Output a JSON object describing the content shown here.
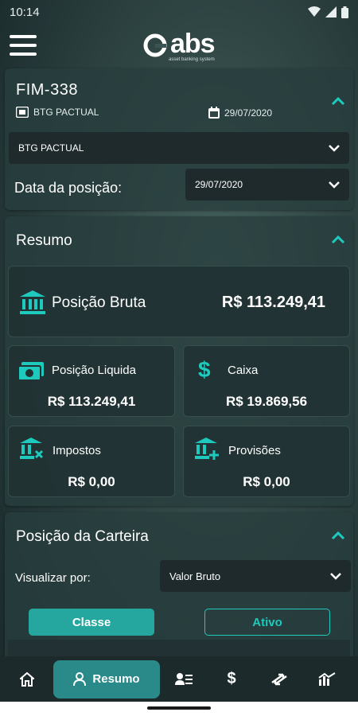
{
  "status_bar": {
    "time": "10:14"
  },
  "brand": {
    "name": "abs",
    "tagline": "asset banking system"
  },
  "colors": {
    "accent": "#1ec9bd",
    "button_fill": "#25a79f",
    "active_nav": "#2a8a8a",
    "card": "#283e3e",
    "select_bg": "#1f2a2c"
  },
  "header_card": {
    "fund_code": "FIM-338",
    "bank": "BTG PACTUAL",
    "date": "29/07/2020",
    "bank_select": "BTG PACTUAL",
    "position_date_label": "Data da posição:",
    "position_date_value": "29/07/2020"
  },
  "summary": {
    "title": "Resumo",
    "gross": {
      "label": "Posição Bruta",
      "value": "R$ 113.249,41"
    },
    "tiles": [
      {
        "label": "Posição Liquida",
        "value": "R$ 113.249,41",
        "icon": "cash-icon"
      },
      {
        "label": "Caixa",
        "value": "R$ 19.869,56",
        "icon": "dollar-icon"
      },
      {
        "label": "Impostos",
        "value": "R$ 0,00",
        "icon": "bank-tax-icon"
      },
      {
        "label": "Provisões",
        "value": "R$ 0,00",
        "icon": "bank-plus-icon"
      }
    ]
  },
  "portfolio": {
    "title": "Posição da Carteira",
    "view_by_label": "Visualizar por:",
    "view_by_value": "Valor Bruto",
    "tab_class": "Classe",
    "tab_asset": "Ativo"
  },
  "bottom_nav": {
    "items": [
      "home-icon",
      "resumo",
      "statement-icon",
      "dollar-icon",
      "transfer-icon",
      "chart-icon"
    ],
    "active_label": "Resumo"
  }
}
